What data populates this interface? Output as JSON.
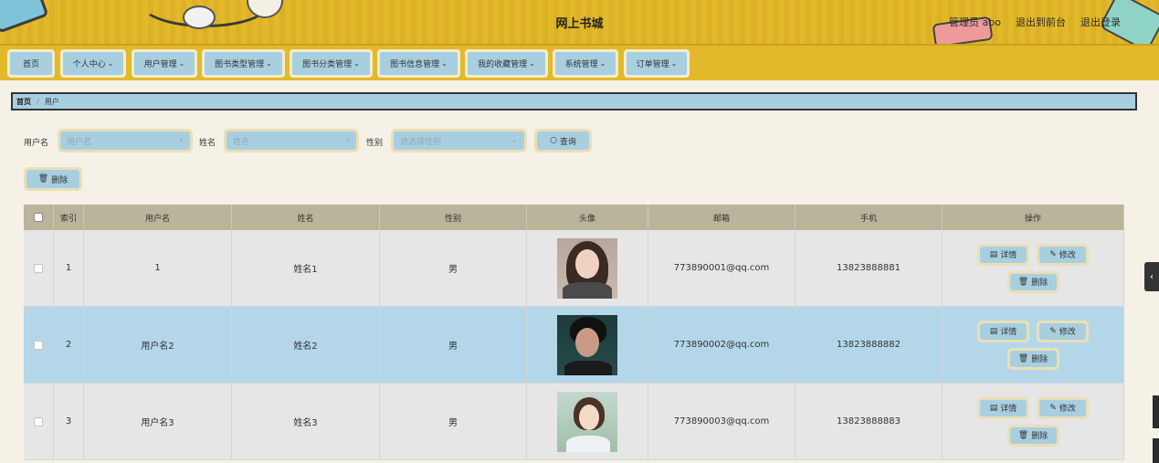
{
  "header": {
    "title": "网上书城",
    "user_label": "管理员 abo",
    "to_front": "退出到前台",
    "logout": "退出登录"
  },
  "nav": {
    "items": [
      {
        "label": "首页"
      },
      {
        "label": "个人中心"
      },
      {
        "label": "用户管理"
      },
      {
        "label": "图书类型管理"
      },
      {
        "label": "图书分类管理"
      },
      {
        "label": "图书信息管理"
      },
      {
        "label": "我的收藏管理"
      },
      {
        "label": "系统管理"
      },
      {
        "label": "订单管理"
      }
    ]
  },
  "breadcrumb": {
    "home": "首页",
    "separator": "/",
    "current": "用户"
  },
  "search": {
    "username_label": "用户名",
    "username_placeholder": "用户名",
    "name_label": "姓名",
    "name_placeholder": "姓名",
    "gender_label": "性别",
    "gender_placeholder": "请选择性别",
    "search_button": "查询",
    "delete_button": "删除"
  },
  "table": {
    "columns": [
      "索引",
      "用户名",
      "姓名",
      "性别",
      "头像",
      "邮箱",
      "手机",
      "操作"
    ],
    "rows": [
      {
        "index": "1",
        "username": "1",
        "name": "姓名1",
        "gender": "男",
        "email": "773890001@qq.com",
        "phone": "13823888881"
      },
      {
        "index": "2",
        "username": "用户名2",
        "name": "姓名2",
        "gender": "男",
        "email": "773890002@qq.com",
        "phone": "13823888882"
      },
      {
        "index": "3",
        "username": "用户名3",
        "name": "姓名3",
        "gender": "男",
        "email": "773890003@qq.com",
        "phone": "13823888883"
      }
    ],
    "actions": {
      "detail": "详情",
      "edit": "修改",
      "delete": "删除"
    }
  },
  "colors": {
    "header_bg": "#e2b92a",
    "button_bg": "#a8cfe0",
    "button_border": "#eadfb7",
    "row_highlight": "#b3d7e8"
  }
}
